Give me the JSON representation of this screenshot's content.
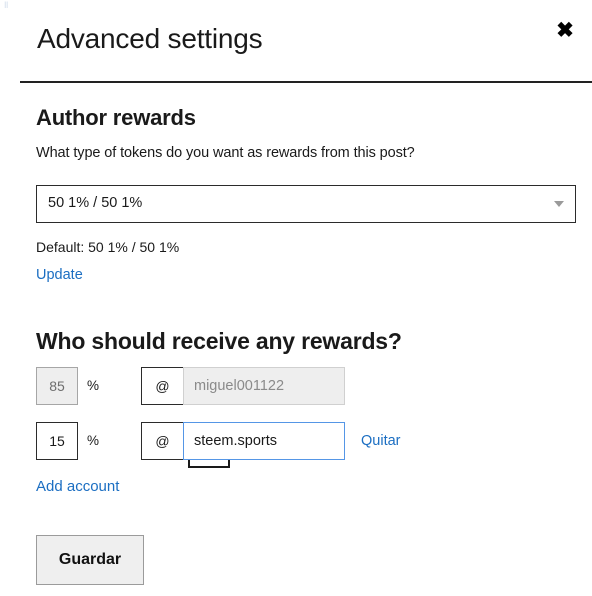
{
  "background": {
    "top_strip_text": "‖  –– –––––  ––  ––– –––––  ––– –– –––––      ● ––––––– –",
    "left_rail_text": "‖\n–\n–\n·\n·"
  },
  "dialog": {
    "title": "Advanced settings",
    "close_icon": "close-icon",
    "close_glyph": "✖"
  },
  "author_rewards": {
    "heading": "Author rewards",
    "question": "What type of tokens do you want as rewards from this post?",
    "select": {
      "selected_value": "50 1% / 50 1%",
      "caret_icon": "chevron-down-icon",
      "options": [
        "50 1% / 50 1%"
      ]
    },
    "default_label": "Default: 50 1% / 50 1%",
    "update_link": "Update"
  },
  "beneficiaries": {
    "heading": "Who should receive any rewards?",
    "percent_symbol": "%",
    "at_symbol": "@",
    "rows": [
      {
        "percent": "85",
        "percent_disabled": true,
        "username": "miguel001122",
        "username_disabled": true,
        "username_placeholder": "",
        "focused": false,
        "remove_label": ""
      },
      {
        "percent": "15",
        "percent_disabled": false,
        "username": "steem.sports",
        "username_disabled": false,
        "username_placeholder": "",
        "focused": true,
        "remove_label": "Quitar"
      }
    ],
    "add_account_link": "Add account"
  },
  "footer": {
    "save_label": "Guardar"
  },
  "colors": {
    "link": "#1b6ec2",
    "focus_border": "#5596e6",
    "border": "#2b2b2b",
    "disabled_bg": "#eeeeee",
    "button_bg": "#efefef"
  }
}
